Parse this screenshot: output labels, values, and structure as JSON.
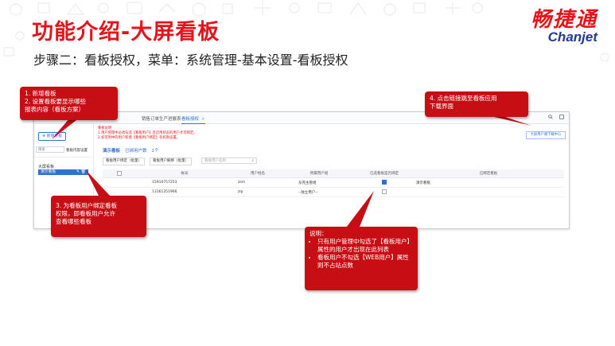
{
  "slide": {
    "title": "功能介绍-大屏看板",
    "subtitle": "步骤二：看板授权，菜单：系统管理-基本设置-看板授权",
    "logo_cn": "畅捷通",
    "logo_en": "Chanjet"
  },
  "app": {
    "tabs": [
      {
        "label": "销售订单生产进展表",
        "active": false
      },
      {
        "label": "看板授权",
        "active": true
      }
    ],
    "tab_close": "×",
    "toolbar_icons": [
      "search-icon",
      "expand-icon"
    ],
    "sidebar": {
      "new_button": "新增看板",
      "search_placeholder": "搜索",
      "config_label": "看板内容设置",
      "group": "大屏看板",
      "item": "演示看板",
      "item_icons": [
        "edit-icon",
        "delete-icon"
      ]
    },
    "notes": [
      "看板说明",
      "1.用户管理中必须勾选【看板用户】且启用状态的用户才可绑定。",
      "2.如可用中的用户新增【看板用户绑定】有权限设置。"
    ],
    "download_link": "大屏用户端下载中心",
    "board": {
      "title": "演示看板",
      "count_label": "已绑用户数",
      "count": "1个"
    },
    "filters": {
      "bind_button": "看板用户绑定（批量）",
      "unbind_button": "看板用户解绑（批量）",
      "search_placeholder": "看板用户名称"
    },
    "table": {
      "columns": [
        "",
        "帐号",
        "用户姓名",
        "所属用户组",
        "已选看板是否绑定",
        "已绑定看板"
      ],
      "rows": [
        {
          "account": "15910757253",
          "name": "zsm",
          "group": "东莞主管组",
          "checked": true,
          "boards": "演示看板"
        },
        {
          "account": "13161351966",
          "name": "zlp",
          "group": "--独立用户--",
          "checked": false,
          "boards": ""
        }
      ]
    }
  },
  "callouts": {
    "c1": [
      "1. 新增看板",
      "2. 设置看板要显示哪些",
      "报表内容（看板方案）"
    ],
    "c3": [
      "3. 为看板用户绑定看板",
      "权限，即看板用户允许",
      "查看哪些看板"
    ],
    "c4": [
      "4. 点击链接跳至看板应用",
      "下载界面"
    ],
    "note_title": "说明：",
    "note_items": [
      "只有用户管理中勾选了【看板用户】属性的用户才出现在此列表",
      "看板用户不勾选【WEB用户】属性则不占站点数"
    ]
  },
  "colors": {
    "accent": "#e5141a",
    "callout": "#c80e15",
    "link": "#2f6fd6",
    "logo_en": "#233a8f"
  }
}
